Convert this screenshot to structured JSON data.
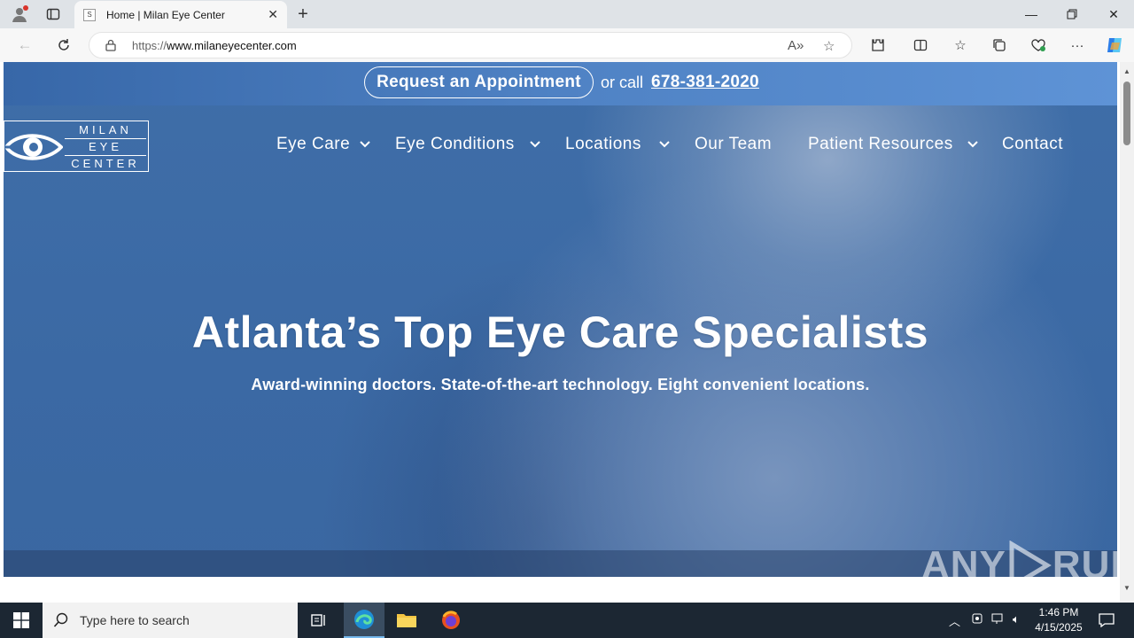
{
  "browser": {
    "tab_title": "Home | Milan Eye Center",
    "favicon_text": "S",
    "url_prefix": "https://",
    "url_domain": "www.milaneyecenter.com"
  },
  "site": {
    "topbar": {
      "appointment_label": "Request an Appointment",
      "or_call": "or call",
      "phone": "678-381-2020"
    },
    "logo": {
      "line1": "MILAN",
      "line2": "EYE",
      "line3": "CENTER"
    },
    "nav": {
      "items": [
        {
          "label": "Eye Care",
          "dropdown": true
        },
        {
          "label": "Eye Conditions",
          "dropdown": true
        },
        {
          "label": "Locations",
          "dropdown": true
        },
        {
          "label": "Our Team",
          "dropdown": false
        },
        {
          "label": "Patient Resources",
          "dropdown": true
        },
        {
          "label": "Contact",
          "dropdown": false
        }
      ]
    },
    "hero": {
      "title": "Atlanta’s Top Eye Care Specialists",
      "subtitle": "Award-winning doctors. State-of-the-art technology. Eight convenient locations."
    }
  },
  "watermark": {
    "text_left": "ANY",
    "text_right": "RUN"
  },
  "taskbar": {
    "search_placeholder": "Type here to search",
    "time": "1:46 PM",
    "date": "4/15/2025"
  }
}
